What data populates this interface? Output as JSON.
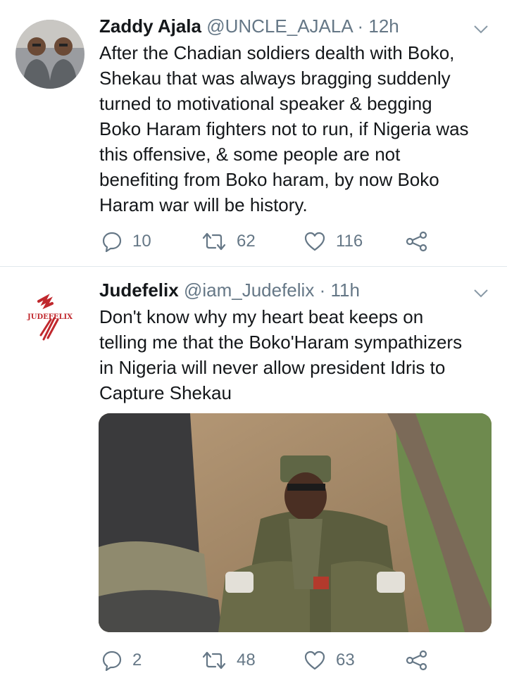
{
  "tweets": [
    {
      "name": "Zaddy Ajala",
      "handle": "@UNCLE_AJALA",
      "separator": "·",
      "time": "12h",
      "text": "After the Chadian soldiers dealth with Boko,\nShekau that was always bragging suddenly\nturned to motivational speaker & begging\nBoko Haram fighters not to run, if Nigeria was\nthis offensive, & some people are not\nbenefiting from Boko haram, by now Boko\nHaram war will be history.",
      "replies": "10",
      "retweets": "62",
      "likes": "116"
    },
    {
      "name": "Judefelix",
      "handle": "@iam_Judefelix",
      "separator": "·",
      "time": "11h",
      "text": "Don't know why my heart beat keeps on\ntelling me that the Boko'Haram sympathizers\nin Nigeria will never allow president Idris to\nCapture Shekau",
      "avatar_logo_text": "JUDEFELIX",
      "replies": "2",
      "retweets": "48",
      "likes": "63"
    }
  ],
  "icons": {
    "reply": "speech-bubble",
    "retweet": "retweet-arrows",
    "like": "heart",
    "share": "share-nodes",
    "menu": "chevron-down"
  },
  "colors": {
    "text": "#14171a",
    "secondary": "#657786",
    "divider": "#e1e8ed",
    "logo_red": "#c0282d"
  }
}
